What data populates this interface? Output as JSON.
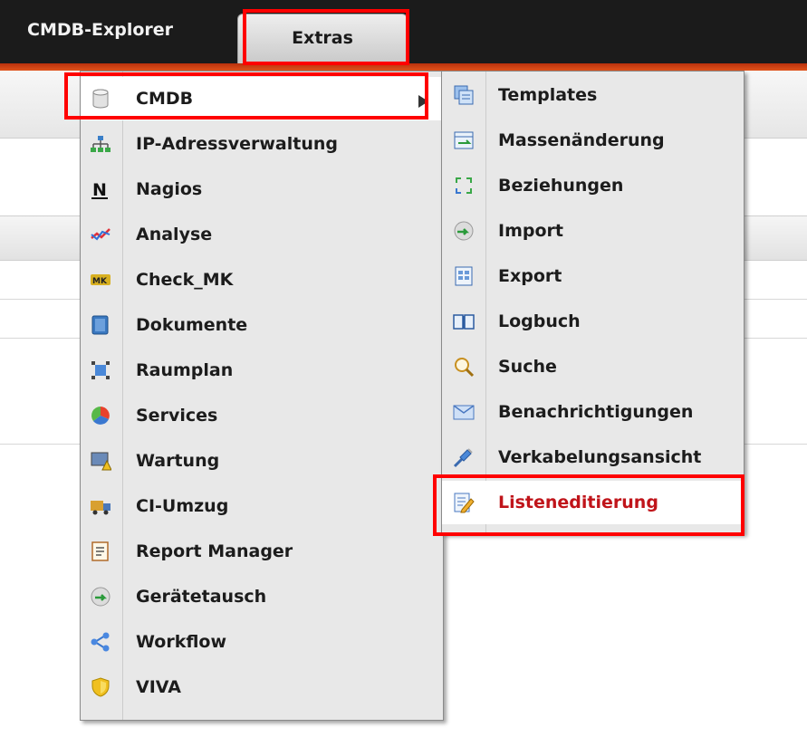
{
  "topbar": {
    "brand": "CMDB-Explorer",
    "active_tab": "Extras"
  },
  "main_menu": {
    "items": [
      {
        "label": "CMDB",
        "icon": "database-icon",
        "has_submenu": true
      },
      {
        "label": "IP-Adressverwaltung",
        "icon": "network-icon"
      },
      {
        "label": "Nagios",
        "icon": "nagios-icon"
      },
      {
        "label": "Analyse",
        "icon": "analysis-icon"
      },
      {
        "label": "Check_MK",
        "icon": "check-mk-icon"
      },
      {
        "label": "Dokumente",
        "icon": "document-icon"
      },
      {
        "label": "Raumplan",
        "icon": "floorplan-icon"
      },
      {
        "label": "Services",
        "icon": "services-icon"
      },
      {
        "label": "Wartung",
        "icon": "maintenance-icon"
      },
      {
        "label": "CI-Umzug",
        "icon": "truck-icon"
      },
      {
        "label": "Report Manager",
        "icon": "report-icon"
      },
      {
        "label": "Gerätetausch",
        "icon": "swap-icon"
      },
      {
        "label": "Workflow",
        "icon": "workflow-icon"
      },
      {
        "label": "VIVA",
        "icon": "shield-icon"
      }
    ]
  },
  "sub_menu": {
    "items": [
      {
        "label": "Templates",
        "icon": "templates-icon"
      },
      {
        "label": "Massenänderung",
        "icon": "mass-change-icon"
      },
      {
        "label": "Beziehungen",
        "icon": "relations-icon"
      },
      {
        "label": "Import",
        "icon": "import-icon"
      },
      {
        "label": "Export",
        "icon": "export-icon"
      },
      {
        "label": "Logbuch",
        "icon": "book-icon"
      },
      {
        "label": "Suche",
        "icon": "search-icon"
      },
      {
        "label": "Benachrichtigungen",
        "icon": "mail-icon"
      },
      {
        "label": "Verkabelungsansicht",
        "icon": "cable-icon"
      },
      {
        "label": "Listeneditierung",
        "icon": "list-edit-icon",
        "highlighted": true
      }
    ]
  },
  "colors": {
    "topbar": "#1b1b1b",
    "accent": "#e0541c",
    "highlight_box": "#ff0000",
    "highlight_text": "#c0141a"
  }
}
